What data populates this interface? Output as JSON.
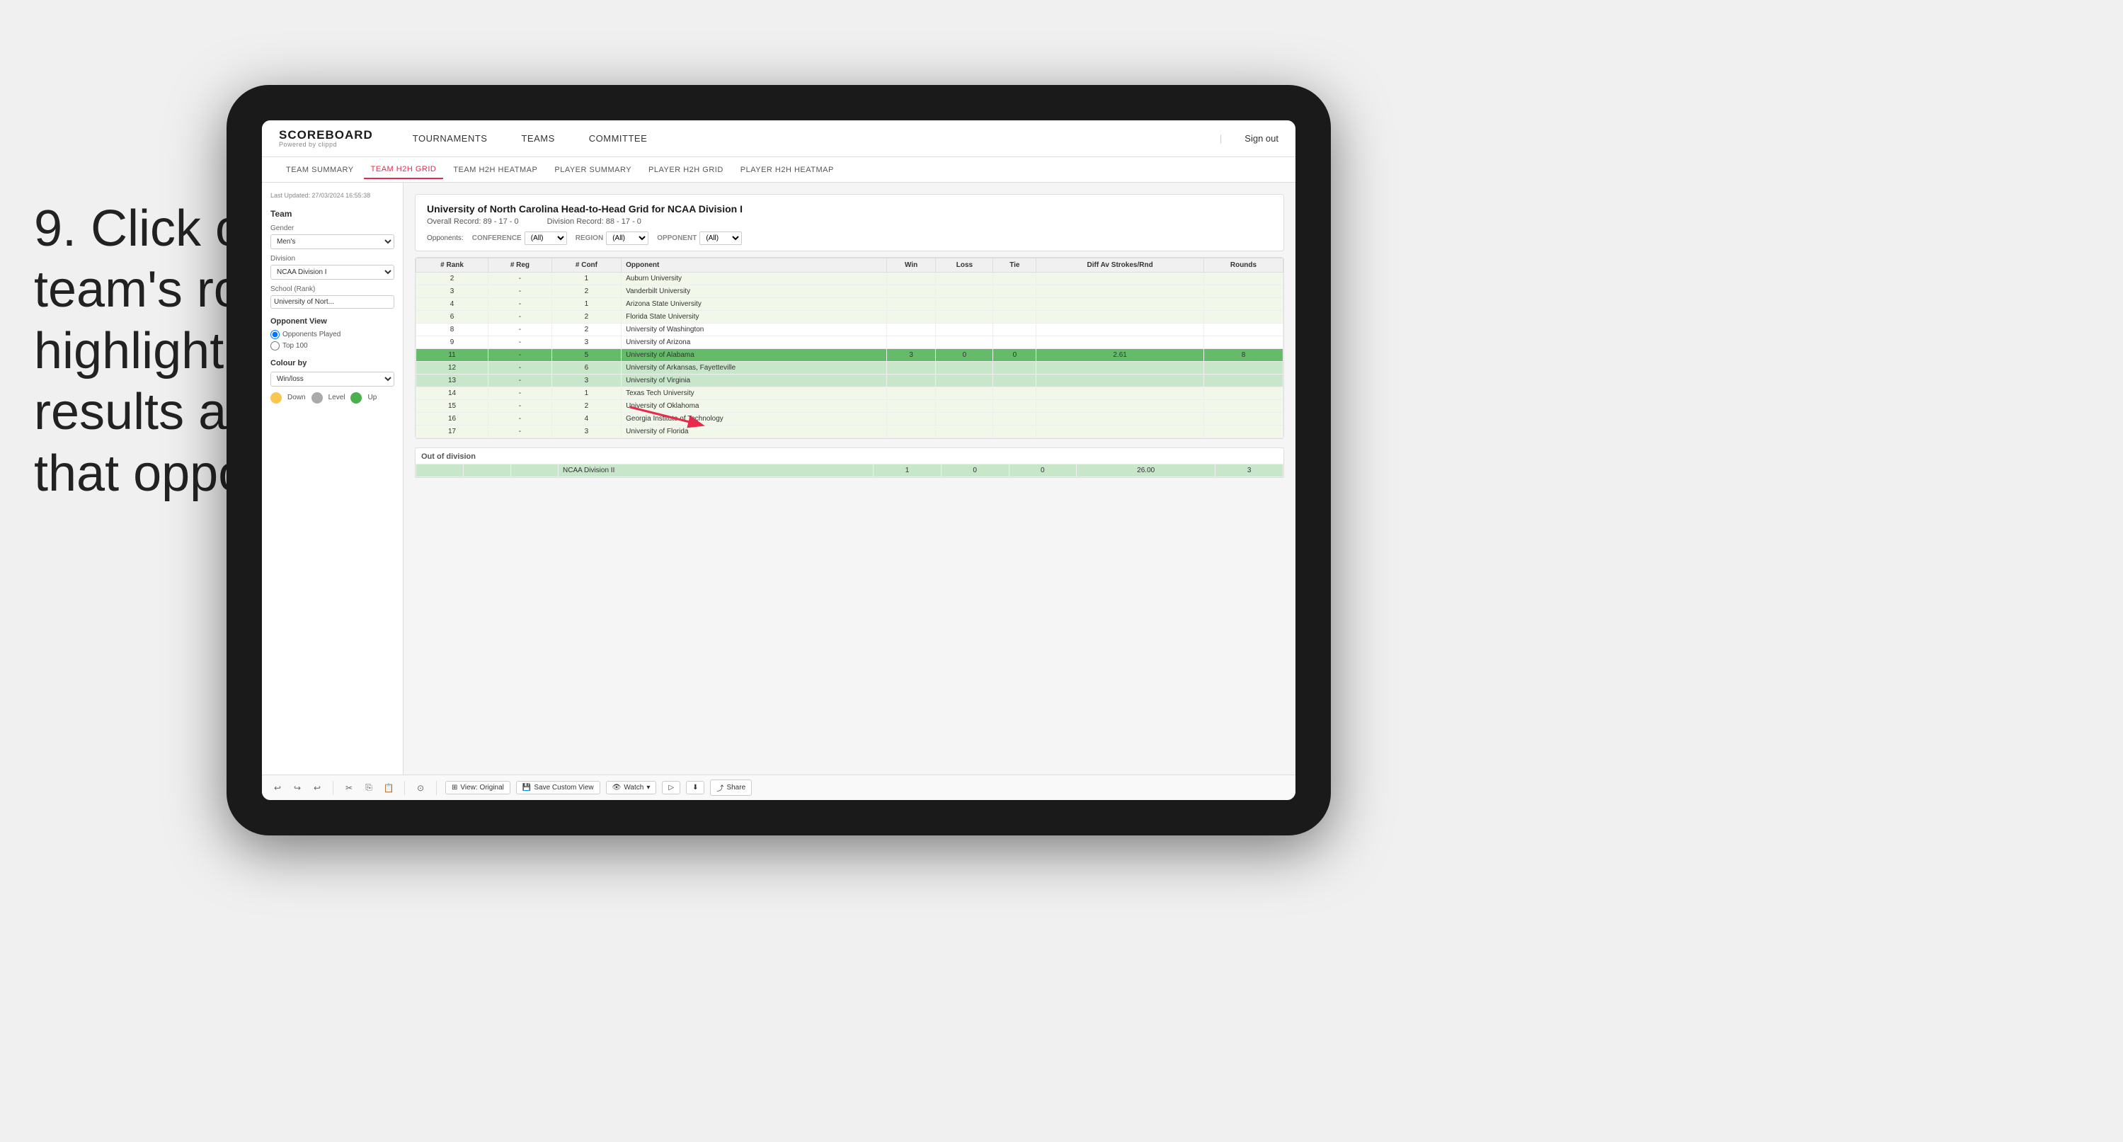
{
  "instruction": {
    "step": "9.",
    "text": "Click on a team's row to highlight results against that opponent"
  },
  "nav": {
    "logo": "SCOREBOARD",
    "logo_sub": "Powered by clippd",
    "items": [
      "TOURNAMENTS",
      "TEAMS",
      "COMMITTEE"
    ],
    "sign_out": "Sign out"
  },
  "sub_nav": {
    "items": [
      "TEAM SUMMARY",
      "TEAM H2H GRID",
      "TEAM H2H HEATMAP",
      "PLAYER SUMMARY",
      "PLAYER H2H GRID",
      "PLAYER H2H HEATMAP"
    ],
    "active": "TEAM H2H GRID"
  },
  "left_panel": {
    "timestamp": "Last Updated: 27/03/2024\n16:55:38",
    "team_label": "Team",
    "gender_label": "Gender",
    "gender_value": "Men's",
    "division_label": "Division",
    "division_value": "NCAA Division I",
    "school_label": "School (Rank)",
    "school_value": "University of Nort...",
    "opponent_view_title": "Opponent View",
    "radio_options": [
      "Opponents Played",
      "Top 100"
    ],
    "radio_selected": "Opponents Played",
    "colour_by_title": "Colour by",
    "colour_value": "Win/loss",
    "legend": [
      {
        "color": "#f9c74f",
        "label": "Down"
      },
      {
        "color": "#aaa",
        "label": "Level"
      },
      {
        "color": "#4caf50",
        "label": "Up"
      }
    ]
  },
  "grid": {
    "title": "University of North Carolina Head-to-Head Grid for NCAA Division I",
    "overall_record": "Overall Record: 89 - 17 - 0",
    "division_record": "Division Record: 88 - 17 - 0",
    "filters": {
      "opponents_label": "Opponents:",
      "conference_label": "Conference",
      "conference_value": "(All)",
      "region_label": "Region",
      "region_value": "(All)",
      "opponent_label": "Opponent",
      "opponent_value": "(All)"
    },
    "columns": [
      "# Rank",
      "# Reg",
      "# Conf",
      "Opponent",
      "Win",
      "Loss",
      "Tie",
      "Diff Av Strokes/Rnd",
      "Rounds"
    ],
    "rows": [
      {
        "rank": "2",
        "reg": "-",
        "conf": "1",
        "opponent": "Auburn University",
        "win": "",
        "loss": "",
        "tie": "",
        "diff": "",
        "rounds": "",
        "color": "light"
      },
      {
        "rank": "3",
        "reg": "-",
        "conf": "2",
        "opponent": "Vanderbilt University",
        "win": "",
        "loss": "",
        "tie": "",
        "diff": "",
        "rounds": "",
        "color": "light"
      },
      {
        "rank": "4",
        "reg": "-",
        "conf": "1",
        "opponent": "Arizona State University",
        "win": "",
        "loss": "",
        "tie": "",
        "diff": "",
        "rounds": "",
        "color": "light"
      },
      {
        "rank": "6",
        "reg": "-",
        "conf": "2",
        "opponent": "Florida State University",
        "win": "",
        "loss": "",
        "tie": "",
        "diff": "",
        "rounds": "",
        "color": "light"
      },
      {
        "rank": "8",
        "reg": "-",
        "conf": "2",
        "opponent": "University of Washington",
        "win": "",
        "loss": "",
        "tie": "",
        "diff": "",
        "rounds": "",
        "color": "normal"
      },
      {
        "rank": "9",
        "reg": "-",
        "conf": "3",
        "opponent": "University of Arizona",
        "win": "",
        "loss": "",
        "tie": "",
        "diff": "",
        "rounds": "",
        "color": "normal"
      },
      {
        "rank": "11",
        "reg": "-",
        "conf": "5",
        "opponent": "University of Alabama",
        "win": "3",
        "loss": "0",
        "tie": "0",
        "diff": "2.61",
        "rounds": "8",
        "color": "selected"
      },
      {
        "rank": "12",
        "reg": "-",
        "conf": "6",
        "opponent": "University of Arkansas, Fayetteville",
        "win": "",
        "loss": "",
        "tie": "",
        "diff": "",
        "rounds": "",
        "color": "light-green"
      },
      {
        "rank": "13",
        "reg": "-",
        "conf": "3",
        "opponent": "University of Virginia",
        "win": "",
        "loss": "",
        "tie": "",
        "diff": "",
        "rounds": "",
        "color": "light-green"
      },
      {
        "rank": "14",
        "reg": "-",
        "conf": "1",
        "opponent": "Texas Tech University",
        "win": "",
        "loss": "",
        "tie": "",
        "diff": "",
        "rounds": "",
        "color": "light"
      },
      {
        "rank": "15",
        "reg": "-",
        "conf": "2",
        "opponent": "University of Oklahoma",
        "win": "",
        "loss": "",
        "tie": "",
        "diff": "",
        "rounds": "",
        "color": "light"
      },
      {
        "rank": "16",
        "reg": "-",
        "conf": "4",
        "opponent": "Georgia Institute of Technology",
        "win": "",
        "loss": "",
        "tie": "",
        "diff": "",
        "rounds": "",
        "color": "light"
      },
      {
        "rank": "17",
        "reg": "-",
        "conf": "3",
        "opponent": "University of Florida",
        "win": "",
        "loss": "",
        "tie": "",
        "diff": "",
        "rounds": "",
        "color": "light"
      }
    ],
    "out_of_division_title": "Out of division",
    "out_of_division_rows": [
      {
        "opponent": "NCAA Division II",
        "win": "1",
        "loss": "0",
        "tie": "0",
        "diff": "26.00",
        "rounds": "3"
      }
    ]
  },
  "toolbar": {
    "view_label": "View: Original",
    "save_label": "Save Custom View",
    "watch_label": "Watch",
    "share_label": "Share"
  }
}
